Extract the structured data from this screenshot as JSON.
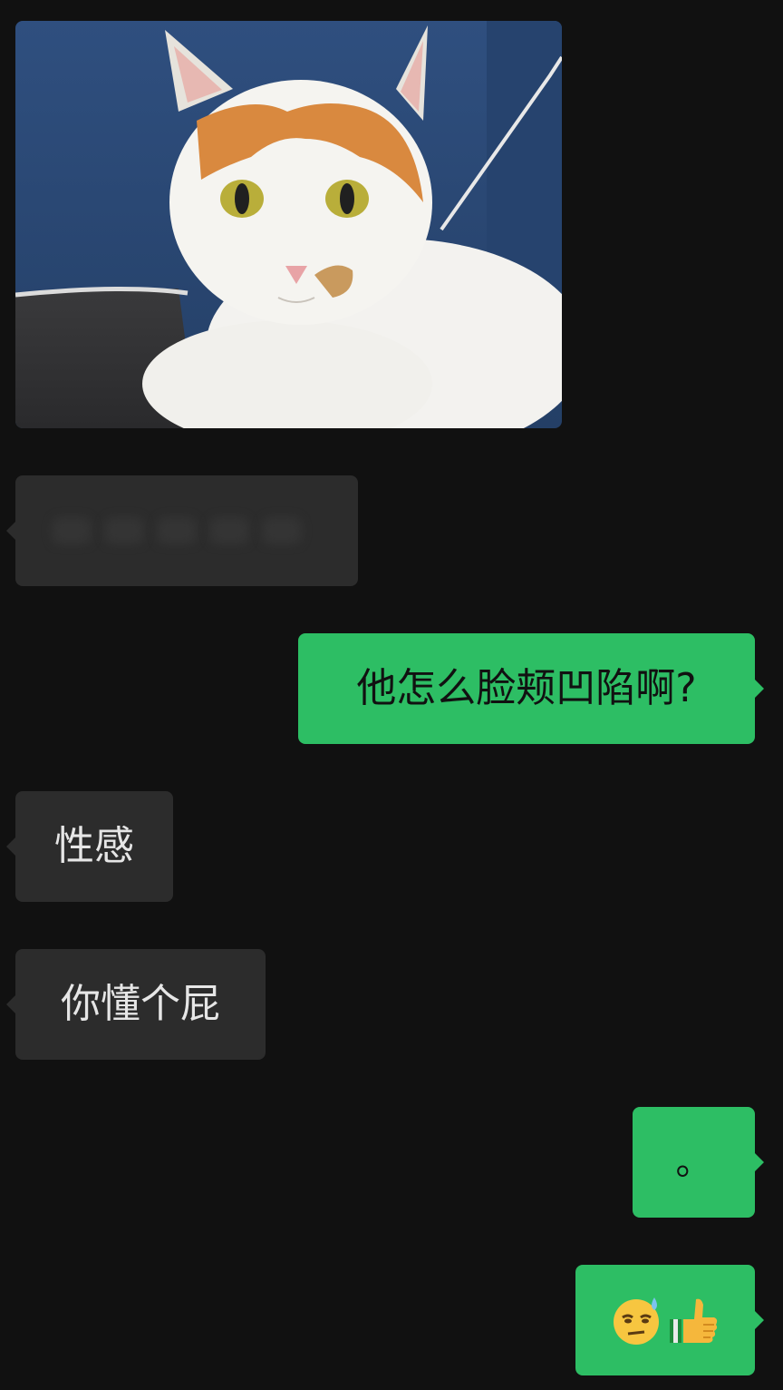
{
  "messages": [
    {
      "id": "photo",
      "direction": "in",
      "type": "image",
      "content": "cat-photo"
    },
    {
      "id": "redacted",
      "direction": "in",
      "type": "text",
      "text": ""
    },
    {
      "id": "m1",
      "direction": "out",
      "type": "text",
      "text": "他怎么脸颊凹陷啊?"
    },
    {
      "id": "m2",
      "direction": "in",
      "type": "text",
      "text": "性感"
    },
    {
      "id": "m3",
      "direction": "in",
      "type": "text",
      "text": "你懂个屁"
    },
    {
      "id": "m4",
      "direction": "out",
      "type": "text",
      "text": "。"
    },
    {
      "id": "m5",
      "direction": "out",
      "type": "emoji",
      "icons": [
        "sweat-face-icon",
        "thumbs-up-icon"
      ]
    }
  ],
  "colors": {
    "background": "#111111",
    "incoming_bubble": "#2c2c2c",
    "outgoing_bubble": "#2dbe64",
    "incoming_text": "#e6e6e6",
    "outgoing_text": "#111111"
  }
}
